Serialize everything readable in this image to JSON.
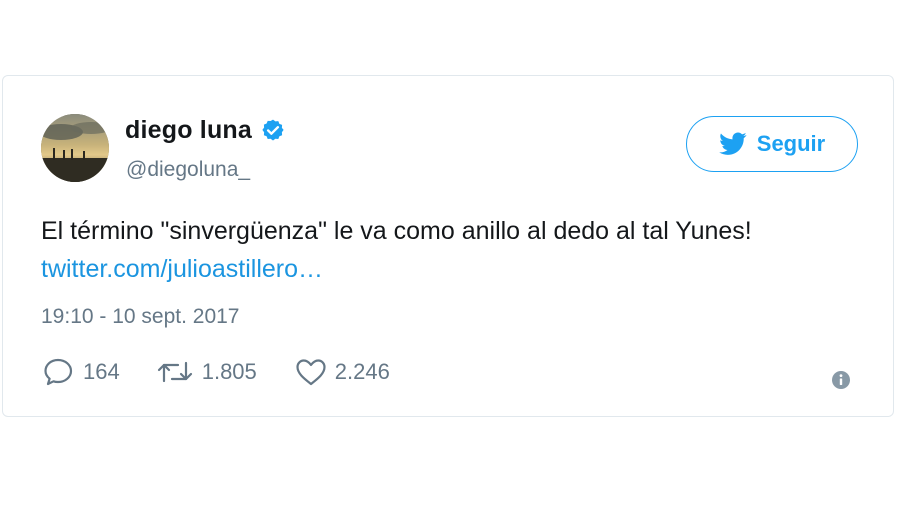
{
  "tweet": {
    "author": {
      "display_name": "diego luna",
      "handle": "@diegoluna_",
      "verified": true
    },
    "follow_label": "Seguir",
    "text_part1": "El término \"sinvergüenza\" le va como anillo al dedo al tal Yunes! ",
    "link_text": "twitter.com/julioastillero…",
    "timestamp": "19:10 - 10 sept. 2017",
    "stats": {
      "replies": "164",
      "retweets": "1.805",
      "likes": "2.246"
    }
  },
  "colors": {
    "accent": "#1da1f2",
    "link": "#1b95e0",
    "muted": "#657786",
    "text": "#14171a",
    "border": "#e1e8ed"
  },
  "icons": [
    "verified-badge-icon",
    "twitter-bird-icon",
    "reply-icon",
    "retweet-icon",
    "like-icon",
    "info-icon"
  ]
}
